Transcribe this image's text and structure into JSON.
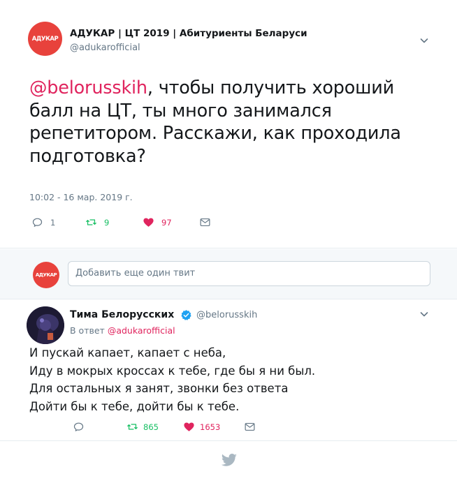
{
  "main_tweet": {
    "avatar_text": "АДУКАР",
    "account_name": "АДУКАР | ЦТ 2019 | Абитуриенты Беларуси",
    "handle": "@adukarofficial",
    "mention": "@belorusskih",
    "text_line1_rest": ", чтобы получить хороший",
    "text_line2": "балл на ЦТ, ты много занимался",
    "text_line3": "репетитором. Расскажи, как проходила",
    "text_line4": "подготовка?",
    "timestamp": "10:02 - 16 мар. 2019 г.",
    "reply_count": "1",
    "retweet_count": "9",
    "like_count": "97"
  },
  "reply_box": {
    "avatar_text": "АДУКАР",
    "placeholder": "Добавить еще один твит"
  },
  "reply_tweet": {
    "name": "Тима Белорусских",
    "handle": "@belorusskih",
    "in_reply_prefix": "В ответ",
    "in_reply_handle": "@adukarofficial",
    "lines": [
      "И пускай капает, капает с неба,",
      "Иду в мокрых кроссах к тебе, где бы я ни был.",
      "Для остальных я занят, звонки без ответа",
      "Дойти бы к тебе, дойти бы к тебе."
    ],
    "retweet_count": "865",
    "like_count": "1653"
  },
  "colors": {
    "brand_red": "#e8423c",
    "retweet_green": "#17bf63",
    "like_red": "#e0245e",
    "icon_gray": "#657786",
    "link_red": "#e0245e"
  },
  "icons": [
    "chevron-down-icon",
    "reply-icon",
    "retweet-icon",
    "heart-icon",
    "message-icon",
    "verified-icon",
    "twitter-bird-icon"
  ]
}
